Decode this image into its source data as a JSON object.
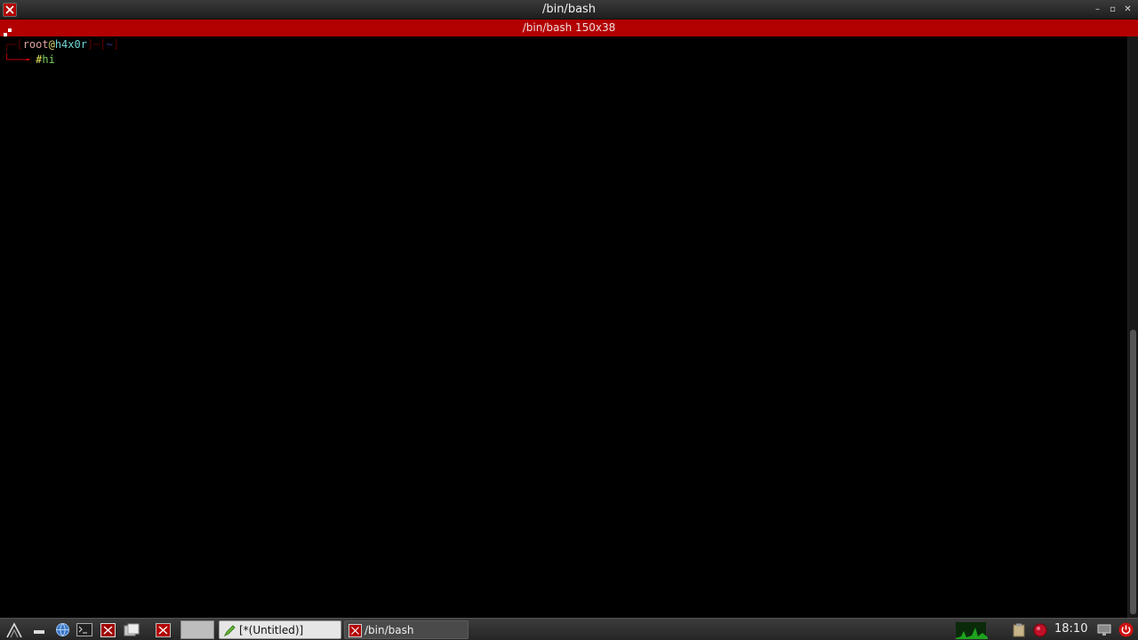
{
  "window": {
    "title": "/bin/bash",
    "buttons": {
      "minimize": "–",
      "maximize": "▫",
      "close": "✕"
    }
  },
  "tab": {
    "title": "/bin/bash 150x38"
  },
  "terminal": {
    "prompt_user": "root",
    "prompt_at": "@",
    "prompt_host": "h4x0r",
    "prompt_dir": "~",
    "prompt_hash": "#",
    "typed_command": "hi"
  },
  "taskbar": {
    "tasks": [
      {
        "label": "[*(Untitled)]",
        "icon": "text-editor-icon"
      },
      {
        "label": "/bin/bash",
        "icon": "terminal-icon"
      }
    ],
    "clock": "18:10"
  },
  "colors": {
    "accent_red": "#b30000",
    "background": "#000000"
  }
}
